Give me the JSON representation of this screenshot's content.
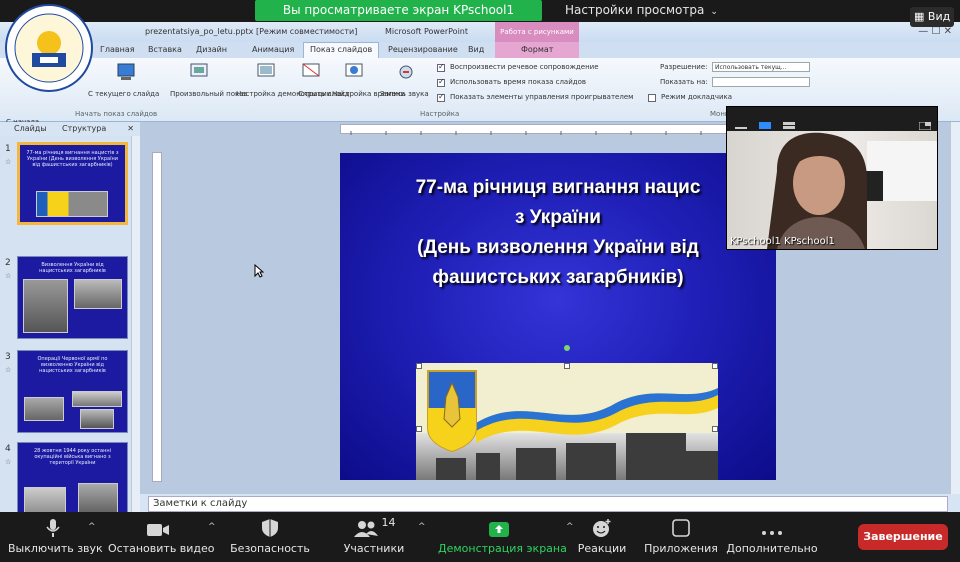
{
  "zoom": {
    "share_banner": "Вы просматриваете экран KPschool1 KPschool1",
    "view_settings": "Настройки просмотра",
    "view_button": "Вид"
  },
  "ppt": {
    "window_title": "prezentatsiya_po_letu.pptx [Режим совместимости]",
    "window_title_app": "Microsoft PowerPoint",
    "context_tab": "Работа с рисунками",
    "tabs": [
      "Главная",
      "Вставка",
      "Дизайн",
      "Анимация",
      "Показ слайдов",
      "Рецензирование",
      "Вид",
      "Формат"
    ],
    "ribbon": {
      "checkbox1": "Воспроизвести речевое сопровождение",
      "checkbox2": "Использовать время показа слайдов",
      "checkbox3": "Показать элементы управления проигрывателем",
      "resolution_label": "Разрешение:",
      "resolution_value": "Использовать текущ...",
      "monitor_label": "Показать на:",
      "presenter_view": "Режим докладчика",
      "group1": "Начать показ слайдов",
      "group2": "Настройка",
      "group3": "Мониторы",
      "btn1": "С начала",
      "btn2": "С текущего слайда",
      "btn3": "Произвольный показ",
      "btn4": "Настройка демонстрации",
      "btn5": "Скрыть слайд",
      "btn6": "Настройка времени",
      "btn7": "Запись звука"
    },
    "left_tabs": {
      "slides": "Слайды",
      "outline": "Структура"
    },
    "thumbnails": [
      {
        "num": "1",
        "text": "77-ма річниця вигнання нацистів з України (День визволення України від фашистських загарбників)"
      },
      {
        "num": "2",
        "text": "Визволення України від нацистських загарбників"
      },
      {
        "num": "3",
        "text": "Операції Червоної армії по визволенню України від нацистських загарбників"
      },
      {
        "num": "4",
        "text": "28 жовтня 1944 року останні окупаційні війська вигнано з території України"
      }
    ],
    "slide": {
      "title_lines": [
        "77-ма річниця вигнання нацис",
        "з України",
        "(День визволення України від",
        "фашистських загарбників)"
      ]
    },
    "notes_placeholder": "Заметки к слайду"
  },
  "webcam": {
    "name": "KPschool1 KPschool1"
  },
  "toolbar": {
    "mute": "Выключить звук",
    "stop_video": "Остановить видео",
    "security": "Безопасность",
    "participants": "Участники",
    "participants_count": "14",
    "share": "Демонстрация экрана",
    "reactions": "Реакции",
    "apps": "Приложения",
    "more": "Дополнительно",
    "end": "Завершение"
  },
  "colors": {
    "zoom_green": "#22b24c",
    "end_red": "#c82a2a",
    "slide_blue": "#2020b8"
  }
}
